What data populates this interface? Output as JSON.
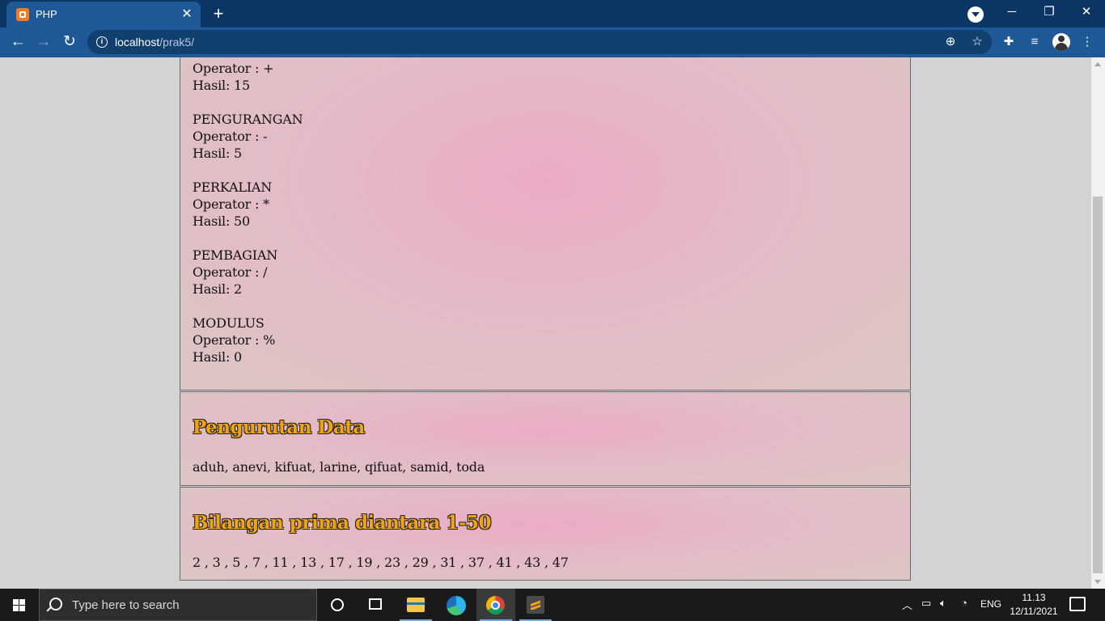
{
  "browser": {
    "tab_title": "PHP",
    "tab_close": "✕",
    "new_tab": "+",
    "url_host": "localhost",
    "url_path": "/prak5/",
    "window_controls": {
      "minimize": "─",
      "restore": "❐",
      "close": "✕"
    }
  },
  "page": {
    "arithmetic": [
      {
        "title": "",
        "operator": "Operator : +",
        "result": "Hasil: 15"
      },
      {
        "title": "PENGURANGAN",
        "operator": "Operator : -",
        "result": "Hasil: 5"
      },
      {
        "title": "PERKALIAN",
        "operator": "Operator : *",
        "result": "Hasil: 50"
      },
      {
        "title": "PEMBAGIAN",
        "operator": "Operator : /",
        "result": "Hasil: 2"
      },
      {
        "title": "MODULUS",
        "operator": "Operator : %",
        "result": "Hasil: 0"
      }
    ],
    "sorting": {
      "heading": "Pengurutan Data",
      "text": "aduh, anevi, kifuat, larine, qifuat, samid, toda"
    },
    "primes": {
      "heading": "Bilangan prima diantara 1-50",
      "text": "2 , 3 , 5 , 7 , 11 , 13 , 17 , 19 , 23 , 29 , 31 , 37 , 41 , 43 , 47"
    }
  },
  "taskbar": {
    "search_placeholder": "Type here to search",
    "language": "ENG",
    "time": "11.13",
    "date": "12/11/2021"
  }
}
